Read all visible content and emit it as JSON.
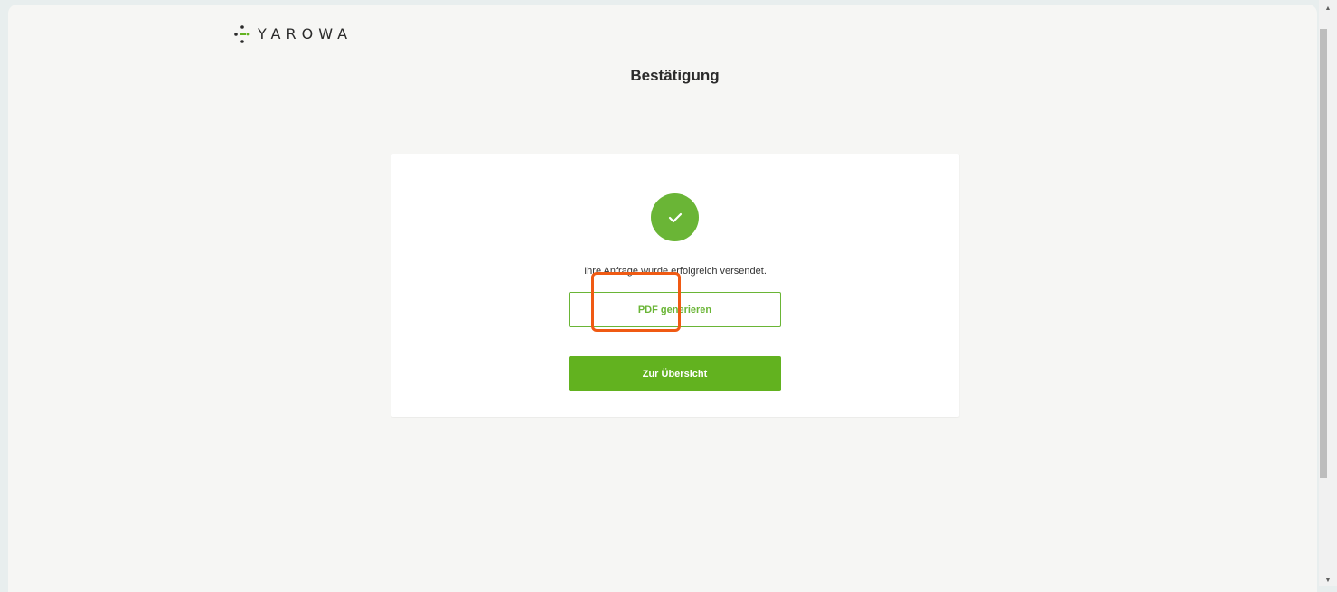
{
  "brand": {
    "name": "YAROWA",
    "icon": "yarowa-logo-mark",
    "color": "#2a2a2a"
  },
  "page": {
    "title": "Bestätigung"
  },
  "card": {
    "status_icon": "checkmark-icon",
    "message": "Ihre Anfrage wurde erfolgreich versendet.",
    "pdf_button_label": "PDF generieren",
    "overview_button_label": "Zur Übersicht"
  },
  "colors": {
    "accent": "#6ab536",
    "primary_button": "#62b21f",
    "highlight": "#f05a13",
    "background": "#f6f6f4"
  },
  "scrollbar": {
    "up_icon": "scroll-up-arrow-icon",
    "down_icon": "scroll-down-arrow-icon"
  }
}
